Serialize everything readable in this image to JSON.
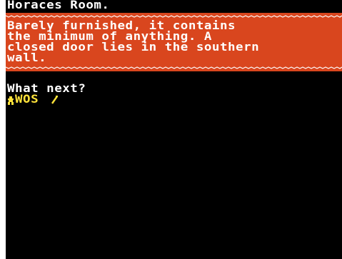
{
  "room": {
    "title": "Horaces Room."
  },
  "description": {
    "lines": [
      "Barely furnished, it contains",
      "the minimum of anything. A",
      "closed door lies in the southern",
      "wall."
    ]
  },
  "prompt": {
    "text": "What next?",
    "input_value": "WOS",
    "player_icon": "figure-icon",
    "cursor_icon": "slash-cursor-icon"
  },
  "colors": {
    "background": "#000000",
    "frame": "#ffffff",
    "panel": "#d9461e",
    "text": "#ffffff",
    "input": "#ffe23a"
  }
}
